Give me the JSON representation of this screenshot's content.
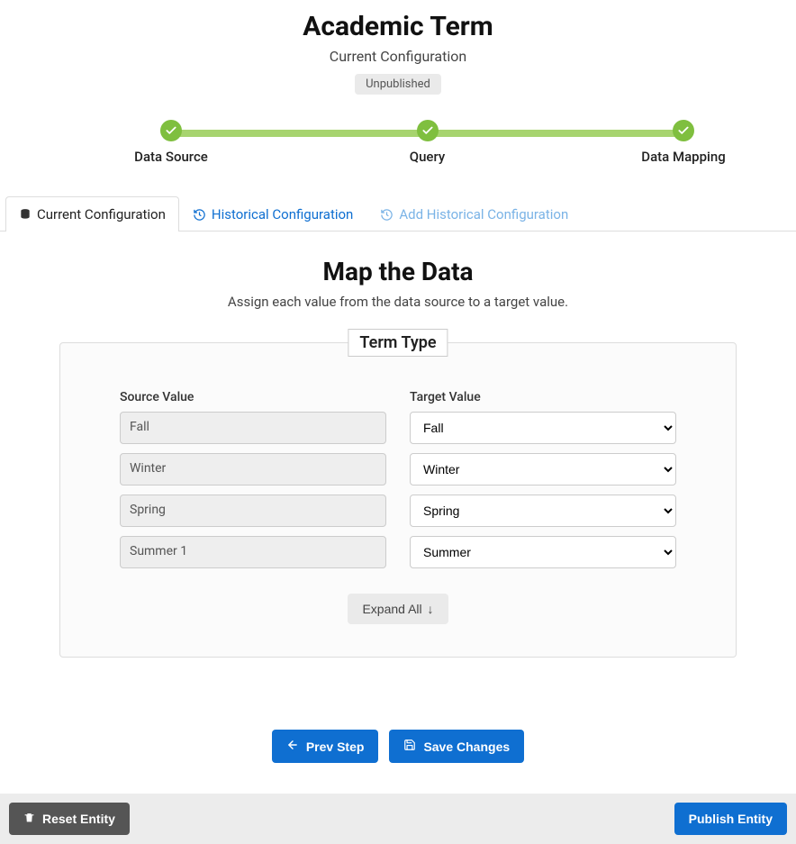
{
  "header": {
    "title": "Academic Term",
    "subtitle": "Current Configuration",
    "status_badge": "Unpublished"
  },
  "stepper": {
    "steps": [
      {
        "label": "Data Source"
      },
      {
        "label": "Query"
      },
      {
        "label": "Data Mapping"
      }
    ]
  },
  "tabs": {
    "current": "Current Configuration",
    "historical": "Historical Configuration",
    "add_historical": "Add Historical Configuration"
  },
  "section": {
    "title": "Map the Data",
    "description": "Assign each value from the data source to a target value."
  },
  "panel": {
    "legend": "Term Type",
    "source_header": "Source Value",
    "target_header": "Target Value",
    "rows": [
      {
        "source": "Fall",
        "target": "Fall"
      },
      {
        "source": "Winter",
        "target": "Winter"
      },
      {
        "source": "Spring",
        "target": "Spring"
      },
      {
        "source": "Summer 1",
        "target": "Summer"
      }
    ],
    "expand_all": "Expand All"
  },
  "actions": {
    "prev": "Prev Step",
    "save": "Save Changes"
  },
  "footer": {
    "reset": "Reset Entity",
    "publish": "Publish Entity"
  }
}
